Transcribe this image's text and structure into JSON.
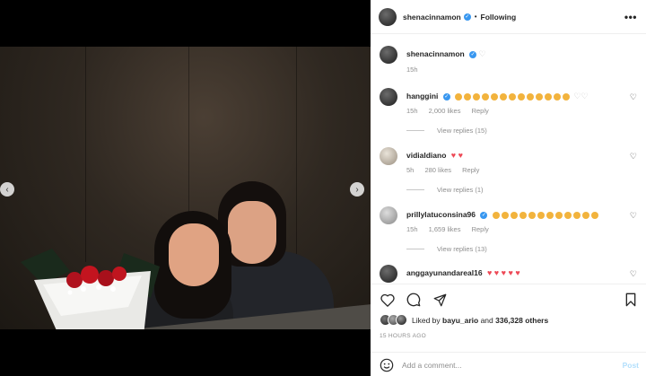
{
  "header": {
    "username": "shenacinnamon",
    "separator": "•",
    "follow_status": "Following",
    "more": "•••"
  },
  "caption": {
    "username": "shenacinnamon",
    "time": "15h"
  },
  "comments": [
    {
      "username": "hanggini",
      "verified": true,
      "emoji_count": 13,
      "time": "15h",
      "likes": "2,000 likes",
      "reply": "Reply",
      "view_replies": "View replies (15)"
    },
    {
      "username": "vidialdiano",
      "verified": false,
      "text": "♥ ♥",
      "time": "5h",
      "likes": "280 likes",
      "reply": "Reply",
      "view_replies": "View replies (1)"
    },
    {
      "username": "prillylatuconsina96",
      "verified": true,
      "emoji_count": 12,
      "time": "15h",
      "likes": "1,659 likes",
      "reply": "Reply",
      "view_replies": "View replies (13)"
    },
    {
      "username": "anggayunandareal16",
      "verified": false,
      "text": "♥ ♥ ♥ ♥ ♥"
    }
  ],
  "likes": {
    "prefix": "Liked by",
    "user": "bayu_ario",
    "connector": "and",
    "others": "336,328 others"
  },
  "time_ago": "15 HOURS AGO",
  "add_comment": {
    "placeholder": "Add a comment...",
    "post": "Post"
  },
  "carousel": {
    "slides": 6,
    "active": 2
  },
  "colors": {
    "verified": "#3897f0",
    "heart": "#ed4956",
    "post_disabled": "#b2dffc",
    "carousel_active": "#4aa3ff"
  }
}
